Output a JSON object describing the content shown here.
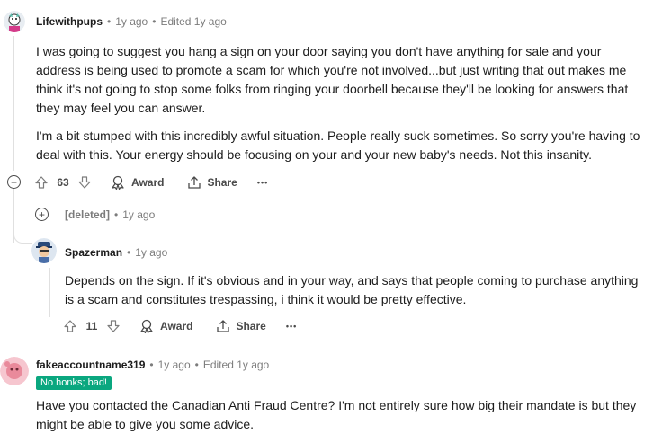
{
  "comments": [
    {
      "username": "Lifewithpups",
      "age": "1y ago",
      "edited": "Edited 1y ago",
      "paragraphs": [
        "I was going to suggest you hang a sign on your door saying you don't have anything for sale and your",
        "address is being used to promote a scam for which you're not involved...but just writing that out makes me",
        "think it's not going to stop some folks from ringing your doorbell because they'll be looking for answers that",
        "they may feel you can answer.",
        "I'm a bit stumped with this incredibly awful situation. People really suck sometimes. So sorry you're having to",
        "deal with this. Your energy should be focusing on your and your new baby's needs. Not this insanity."
      ],
      "score": "63",
      "award_label": "Award",
      "share_label": "Share",
      "more_label": "•••"
    },
    {
      "username": "[deleted]",
      "age": "1y ago"
    },
    {
      "username": "Spazerman",
      "age": "1y ago",
      "paragraphs": [
        "Depends on the sign. If it's obvious and in your way, and says that people coming to purchase anything",
        "is a scam and constitutes trespassing, i think it would be pretty effective."
      ],
      "score": "11",
      "award_label": "Award",
      "share_label": "Share",
      "more_label": "•••"
    },
    {
      "username": "fakeaccountname319",
      "age": "1y ago",
      "edited": "Edited 1y ago",
      "flair": "No honks; bad!",
      "paragraphs": [
        "Have you contacted the Canadian Anti Fraud Centre? I'm not entirely sure how big their mandate is but they",
        "might be able to give you some advice."
      ]
    }
  ],
  "separator": "•",
  "collapse_symbol": "−",
  "expand_symbol": "+",
  "colors": {
    "flair_bg": "#0aa77f",
    "meta": "#7c7c7c",
    "thread_line": "#e0e0e0"
  }
}
